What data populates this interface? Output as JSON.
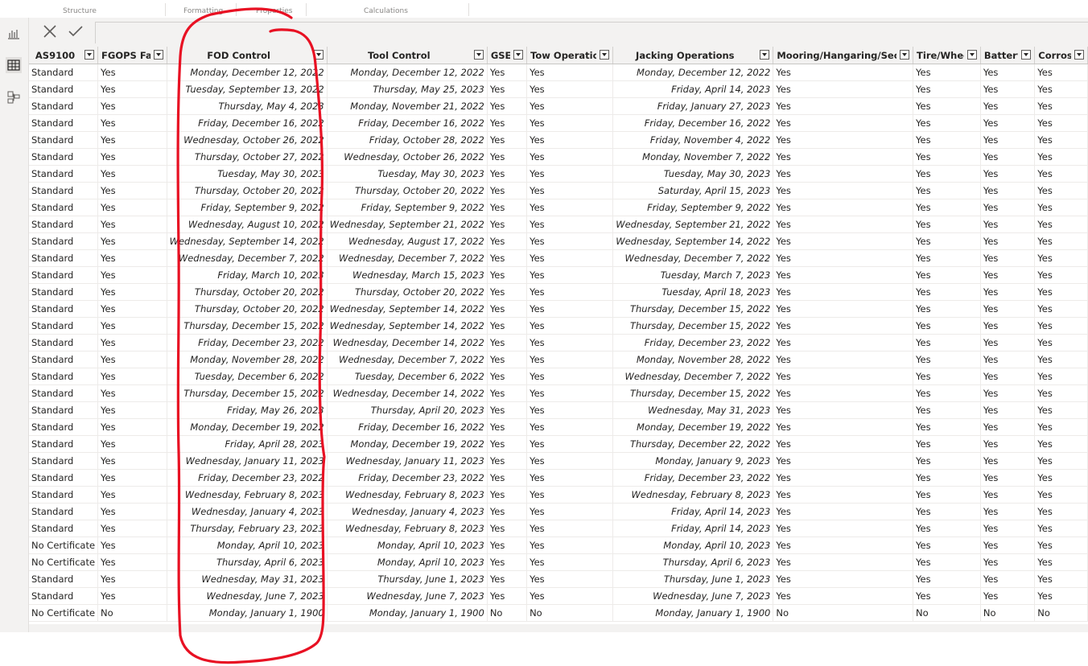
{
  "ribbon": {
    "labels": [
      "Structure",
      "Formatting",
      "Properties",
      "Calculations"
    ]
  },
  "left_rail": {
    "icons": [
      "report-view-icon",
      "data-view-icon",
      "model-view-icon"
    ]
  },
  "formula_bar": {
    "cancel_icon": "close-icon",
    "commit_icon": "checkmark-icon",
    "value": ""
  },
  "columns": [
    {
      "label": "AS9100",
      "width": 82,
      "align": "left",
      "header_align": "center",
      "type": "text"
    },
    {
      "label": "FGOPS Fam",
      "width": 95,
      "align": "left",
      "header_align": "left",
      "type": "text"
    },
    {
      "label": "FOD Control",
      "width": 177,
      "align": "right",
      "header_align": "center",
      "type": "date"
    },
    {
      "label": "Tool Control",
      "width": 177,
      "align": "right",
      "header_align": "center",
      "type": "date"
    },
    {
      "label": "GSE",
      "width": 53,
      "align": "left",
      "header_align": "left",
      "type": "text"
    },
    {
      "label": "Tow Operations",
      "width": 120,
      "align": "left",
      "header_align": "left",
      "type": "text"
    },
    {
      "label": "Jacking Operations",
      "width": 176,
      "align": "right",
      "header_align": "center",
      "type": "date"
    },
    {
      "label": "Mooring/Hangaring/Security",
      "width": 197,
      "align": "left",
      "header_align": "left",
      "type": "text"
    },
    {
      "label": "Tire/Wheel",
      "width": 93,
      "align": "left",
      "header_align": "left",
      "type": "text"
    },
    {
      "label": "Battery",
      "width": 74,
      "align": "left",
      "header_align": "left",
      "type": "text"
    },
    {
      "label": "Corrosion",
      "width": 72,
      "align": "left",
      "header_align": "left",
      "type": "text"
    }
  ],
  "rows": [
    [
      "Standard",
      "Yes",
      "Monday, December 12, 2022",
      "Monday, December 12, 2022",
      "Yes",
      "Yes",
      "Monday, December 12, 2022",
      "Yes",
      "Yes",
      "Yes",
      "Yes"
    ],
    [
      "Standard",
      "Yes",
      "Tuesday, September 13, 2022",
      "Thursday, May 25, 2023",
      "Yes",
      "Yes",
      "Friday, April 14, 2023",
      "Yes",
      "Yes",
      "Yes",
      "Yes"
    ],
    [
      "Standard",
      "Yes",
      "Thursday, May 4, 2023",
      "Monday, November 21, 2022",
      "Yes",
      "Yes",
      "Friday, January 27, 2023",
      "Yes",
      "Yes",
      "Yes",
      "Yes"
    ],
    [
      "Standard",
      "Yes",
      "Friday, December 16, 2022",
      "Friday, December 16, 2022",
      "Yes",
      "Yes",
      "Friday, December 16, 2022",
      "Yes",
      "Yes",
      "Yes",
      "Yes"
    ],
    [
      "Standard",
      "Yes",
      "Wednesday, October 26, 2022",
      "Friday, October 28, 2022",
      "Yes",
      "Yes",
      "Friday, November 4, 2022",
      "Yes",
      "Yes",
      "Yes",
      "Yes"
    ],
    [
      "Standard",
      "Yes",
      "Thursday, October 27, 2022",
      "Wednesday, October 26, 2022",
      "Yes",
      "Yes",
      "Monday, November 7, 2022",
      "Yes",
      "Yes",
      "Yes",
      "Yes"
    ],
    [
      "Standard",
      "Yes",
      "Tuesday, May 30, 2023",
      "Tuesday, May 30, 2023",
      "Yes",
      "Yes",
      "Tuesday, May 30, 2023",
      "Yes",
      "Yes",
      "Yes",
      "Yes"
    ],
    [
      "Standard",
      "Yes",
      "Thursday, October 20, 2022",
      "Thursday, October 20, 2022",
      "Yes",
      "Yes",
      "Saturday, April 15, 2023",
      "Yes",
      "Yes",
      "Yes",
      "Yes"
    ],
    [
      "Standard",
      "Yes",
      "Friday, September 9, 2022",
      "Friday, September 9, 2022",
      "Yes",
      "Yes",
      "Friday, September 9, 2022",
      "Yes",
      "Yes",
      "Yes",
      "Yes"
    ],
    [
      "Standard",
      "Yes",
      "Wednesday, August 10, 2022",
      "Wednesday, September 21, 2022",
      "Yes",
      "Yes",
      "Wednesday, September 21, 2022",
      "Yes",
      "Yes",
      "Yes",
      "Yes"
    ],
    [
      "Standard",
      "Yes",
      "Wednesday, September 14, 2022",
      "Wednesday, August 17, 2022",
      "Yes",
      "Yes",
      "Wednesday, September 14, 2022",
      "Yes",
      "Yes",
      "Yes",
      "Yes"
    ],
    [
      "Standard",
      "Yes",
      "Wednesday, December 7, 2022",
      "Wednesday, December 7, 2022",
      "Yes",
      "Yes",
      "Wednesday, December 7, 2022",
      "Yes",
      "Yes",
      "Yes",
      "Yes"
    ],
    [
      "Standard",
      "Yes",
      "Friday, March 10, 2023",
      "Wednesday, March 15, 2023",
      "Yes",
      "Yes",
      "Tuesday, March 7, 2023",
      "Yes",
      "Yes",
      "Yes",
      "Yes"
    ],
    [
      "Standard",
      "Yes",
      "Thursday, October 20, 2022",
      "Thursday, October 20, 2022",
      "Yes",
      "Yes",
      "Tuesday, April 18, 2023",
      "Yes",
      "Yes",
      "Yes",
      "Yes"
    ],
    [
      "Standard",
      "Yes",
      "Thursday, October 20, 2022",
      "Wednesday, September 14, 2022",
      "Yes",
      "Yes",
      "Thursday, December 15, 2022",
      "Yes",
      "Yes",
      "Yes",
      "Yes"
    ],
    [
      "Standard",
      "Yes",
      "Thursday, December 15, 2022",
      "Wednesday, September 14, 2022",
      "Yes",
      "Yes",
      "Thursday, December 15, 2022",
      "Yes",
      "Yes",
      "Yes",
      "Yes"
    ],
    [
      "Standard",
      "Yes",
      "Friday, December 23, 2022",
      "Wednesday, December 14, 2022",
      "Yes",
      "Yes",
      "Friday, December 23, 2022",
      "Yes",
      "Yes",
      "Yes",
      "Yes"
    ],
    [
      "Standard",
      "Yes",
      "Monday, November 28, 2022",
      "Wednesday, December 7, 2022",
      "Yes",
      "Yes",
      "Monday, November 28, 2022",
      "Yes",
      "Yes",
      "Yes",
      "Yes"
    ],
    [
      "Standard",
      "Yes",
      "Tuesday, December 6, 2022",
      "Tuesday, December 6, 2022",
      "Yes",
      "Yes",
      "Wednesday, December 7, 2022",
      "Yes",
      "Yes",
      "Yes",
      "Yes"
    ],
    [
      "Standard",
      "Yes",
      "Thursday, December 15, 2022",
      "Wednesday, December 14, 2022",
      "Yes",
      "Yes",
      "Thursday, December 15, 2022",
      "Yes",
      "Yes",
      "Yes",
      "Yes"
    ],
    [
      "Standard",
      "Yes",
      "Friday, May 26, 2023",
      "Thursday, April 20, 2023",
      "Yes",
      "Yes",
      "Wednesday, May 31, 2023",
      "Yes",
      "Yes",
      "Yes",
      "Yes"
    ],
    [
      "Standard",
      "Yes",
      "Monday, December 19, 2022",
      "Friday, December 16, 2022",
      "Yes",
      "Yes",
      "Monday, December 19, 2022",
      "Yes",
      "Yes",
      "Yes",
      "Yes"
    ],
    [
      "Standard",
      "Yes",
      "Friday, April 28, 2023",
      "Monday, December 19, 2022",
      "Yes",
      "Yes",
      "Thursday, December 22, 2022",
      "Yes",
      "Yes",
      "Yes",
      "Yes"
    ],
    [
      "Standard",
      "Yes",
      "Wednesday, January 11, 2023",
      "Wednesday, January 11, 2023",
      "Yes",
      "Yes",
      "Monday, January 9, 2023",
      "Yes",
      "Yes",
      "Yes",
      "Yes"
    ],
    [
      "Standard",
      "Yes",
      "Friday, December 23, 2022",
      "Friday, December 23, 2022",
      "Yes",
      "Yes",
      "Friday, December 23, 2022",
      "Yes",
      "Yes",
      "Yes",
      "Yes"
    ],
    [
      "Standard",
      "Yes",
      "Wednesday, February 8, 2023",
      "Wednesday, February 8, 2023",
      "Yes",
      "Yes",
      "Wednesday, February 8, 2023",
      "Yes",
      "Yes",
      "Yes",
      "Yes"
    ],
    [
      "Standard",
      "Yes",
      "Wednesday, January 4, 2023",
      "Wednesday, January 4, 2023",
      "Yes",
      "Yes",
      "Friday, April 14, 2023",
      "Yes",
      "Yes",
      "Yes",
      "Yes"
    ],
    [
      "Standard",
      "Yes",
      "Thursday, February 23, 2023",
      "Wednesday, February 8, 2023",
      "Yes",
      "Yes",
      "Friday, April 14, 2023",
      "Yes",
      "Yes",
      "Yes",
      "Yes"
    ],
    [
      "No Certificate",
      "Yes",
      "Monday, April 10, 2023",
      "Monday, April 10, 2023",
      "Yes",
      "Yes",
      "Monday, April 10, 2023",
      "Yes",
      "Yes",
      "Yes",
      "Yes"
    ],
    [
      "No Certificate",
      "Yes",
      "Thursday, April 6, 2023",
      "Monday, April 10, 2023",
      "Yes",
      "Yes",
      "Thursday, April 6, 2023",
      "Yes",
      "Yes",
      "Yes",
      "Yes"
    ],
    [
      "Standard",
      "Yes",
      "Wednesday, May 31, 2023",
      "Thursday, June 1, 2023",
      "Yes",
      "Yes",
      "Thursday, June 1, 2023",
      "Yes",
      "Yes",
      "Yes",
      "Yes"
    ],
    [
      "Standard",
      "Yes",
      "Wednesday, June 7, 2023",
      "Wednesday, June 7, 2023",
      "Yes",
      "Yes",
      "Wednesday, June 7, 2023",
      "Yes",
      "Yes",
      "Yes",
      "Yes"
    ],
    [
      "No Certificate",
      "No",
      "Monday, January 1, 1900",
      "Monday, January 1, 1900",
      "No",
      "No",
      "Monday, January 1, 1900",
      "No",
      "No",
      "No",
      "No"
    ]
  ],
  "annotation": {
    "type": "freehand-circle",
    "color": "#e81123",
    "target_column": "FOD Control"
  }
}
